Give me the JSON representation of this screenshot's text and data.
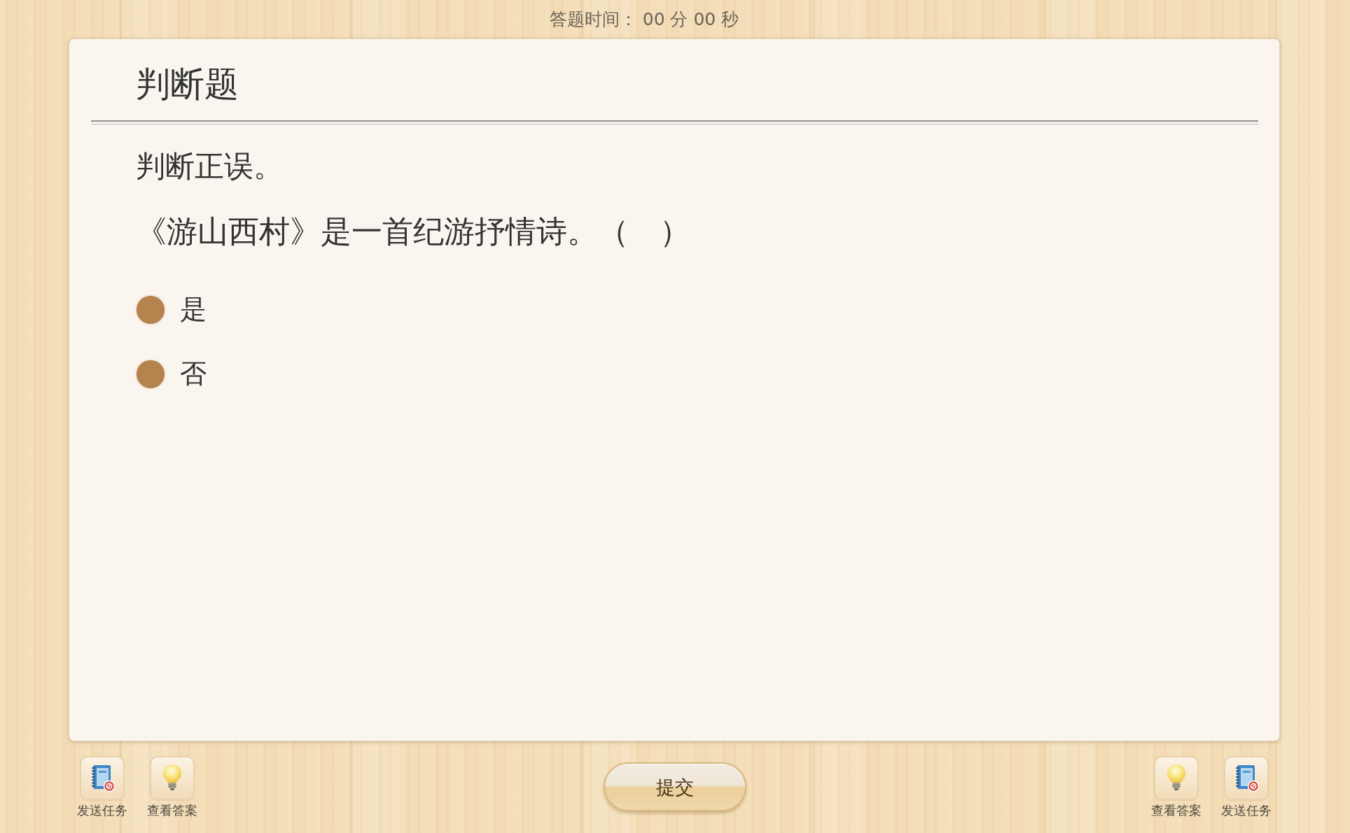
{
  "timer": "答题时间： 00 分 00 秒",
  "question": {
    "type_title": "判断题",
    "instruction": "判断正误。",
    "stem": "《游山西村》是一首纪游抒情诗。（　）",
    "options": [
      {
        "label": "是",
        "selected": false
      },
      {
        "label": "否",
        "selected": false
      }
    ]
  },
  "toolbar_left": [
    {
      "kind": "send_task",
      "label": "发送任务"
    },
    {
      "kind": "view_answer",
      "label": "查看答案"
    }
  ],
  "submit_button": "提交",
  "toolbar_right": [
    {
      "kind": "view_answer",
      "label": "查看答案"
    },
    {
      "kind": "send_task",
      "label": "发送任务"
    }
  ]
}
